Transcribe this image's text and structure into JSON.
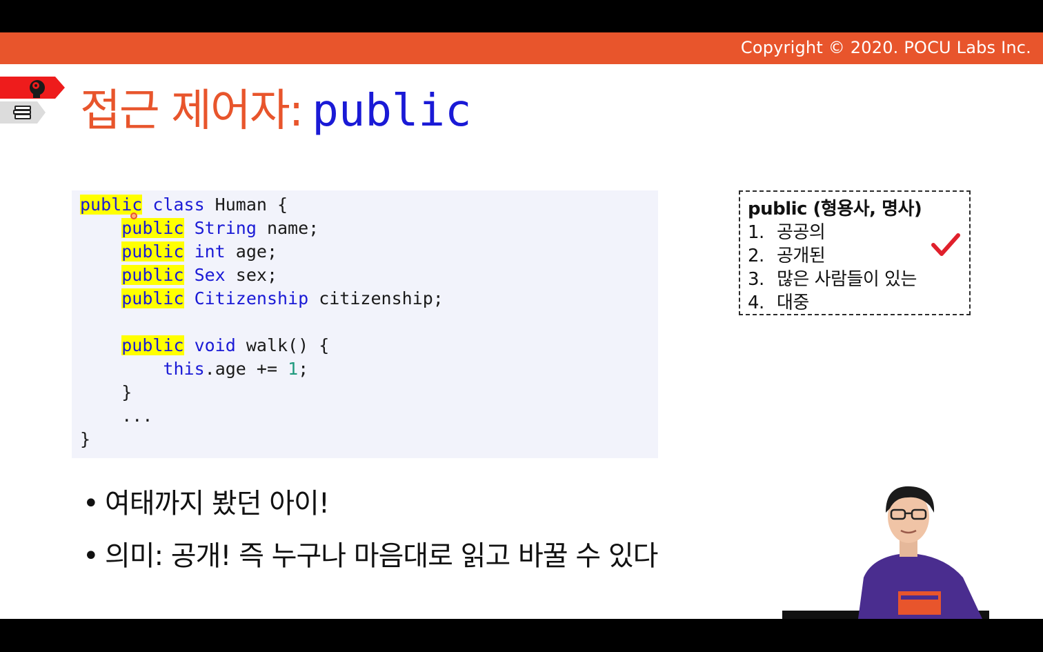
{
  "header": {
    "copyright": "Copyright © 2020. POCU Labs Inc."
  },
  "colors": {
    "accent": "#e8552c",
    "code_keyword": "#1a1ad6",
    "highlight": "#ffff00",
    "number": "#1f9a7e"
  },
  "title": {
    "korean": "접근 제어자:",
    "code": "public"
  },
  "code": {
    "lines": [
      {
        "indent": "",
        "kw_hl": "public",
        "kw": " class",
        "rest": " Human {"
      },
      {
        "indent": "    ",
        "kw_hl": "public",
        "kw": " String",
        "rest": " name;"
      },
      {
        "indent": "    ",
        "kw_hl": "public",
        "kw": " int",
        "rest": " age;"
      },
      {
        "indent": "    ",
        "kw_hl": "public",
        "kw": " Sex",
        "rest": " sex;"
      },
      {
        "indent": "    ",
        "kw_hl": "public",
        "kw": " Citizenship",
        "rest": " citizenship;"
      },
      {
        "indent": "    ",
        "kw_hl": "public",
        "kw": " void",
        "rest": " walk() {"
      },
      {
        "indent": "        ",
        "kw": "this",
        "rest": ".age += ",
        "num": "1",
        "tail": ";"
      },
      {
        "indent": "    ",
        "rest": "}"
      },
      {
        "indent": "    ",
        "rest": "..."
      },
      {
        "indent": "",
        "rest": "}"
      }
    ]
  },
  "definition": {
    "title": "public (형용사, 명사)",
    "items": [
      {
        "num": "1.",
        "text": "공공의"
      },
      {
        "num": "2.",
        "text": "공개된"
      },
      {
        "num": "3.",
        "text": "많은 사람들이 있는"
      },
      {
        "num": "4.",
        "text": "대중"
      }
    ]
  },
  "bullets": [
    {
      "dot": "•",
      "text": "여태까지 봤던 아이!"
    },
    {
      "dot": "•",
      "text": "의미: 공개! 즉 누구나 마음대로 읽고 바꿀 수 있다"
    }
  ],
  "icons": {
    "tab_top": "brain-head-icon",
    "tab_bottom": "books-stack-icon",
    "check": "checkmark-icon"
  }
}
